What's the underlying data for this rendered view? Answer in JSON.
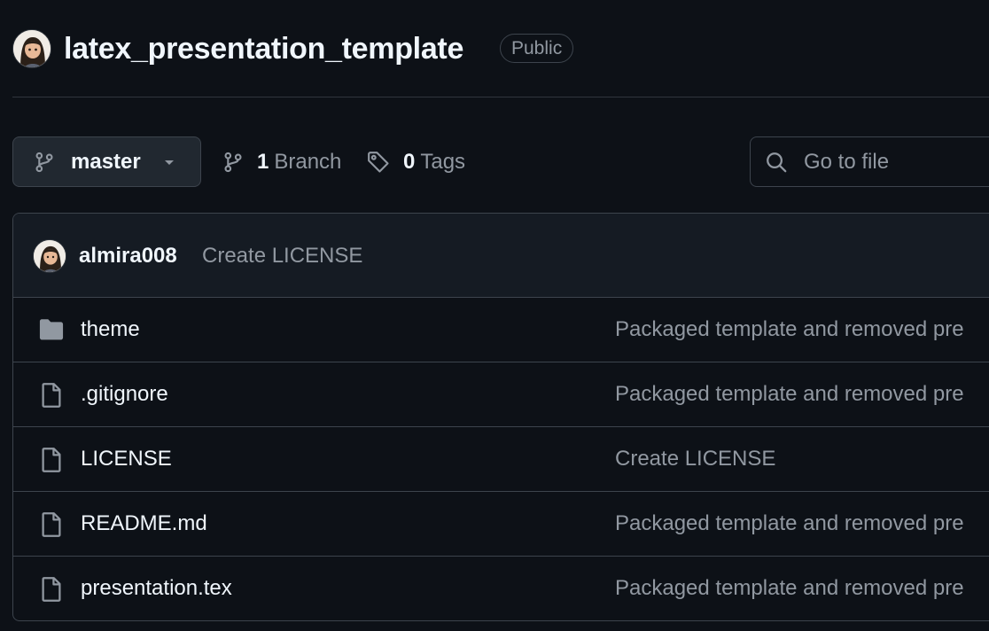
{
  "repo": {
    "name": "latex_presentation_template",
    "visibility": "Public"
  },
  "toolbar": {
    "branch": "master",
    "branch_count": "1",
    "branch_label": "Branch",
    "tag_count": "0",
    "tag_label": "Tags",
    "search_placeholder": "Go to file"
  },
  "latest_commit": {
    "author": "almira008",
    "message": "Create LICENSE"
  },
  "files": [
    {
      "name": "theme",
      "type": "folder",
      "icon": "folder-icon",
      "message": "Packaged template and removed pre"
    },
    {
      "name": ".gitignore",
      "type": "file",
      "icon": "file-icon",
      "message": "Packaged template and removed pre"
    },
    {
      "name": "LICENSE",
      "type": "file",
      "icon": "file-icon",
      "message": "Create LICENSE"
    },
    {
      "name": "README.md",
      "type": "file",
      "icon": "file-icon",
      "message": "Packaged template and removed pre"
    },
    {
      "name": "presentation.tex",
      "type": "file",
      "icon": "file-icon",
      "message": "Packaged template and removed pre"
    }
  ],
  "colors": {
    "background": "#0d1117",
    "border": "#3d444d",
    "text_primary": "#f0f6fc",
    "text_muted": "#9198a1",
    "button_bg": "#212830"
  }
}
